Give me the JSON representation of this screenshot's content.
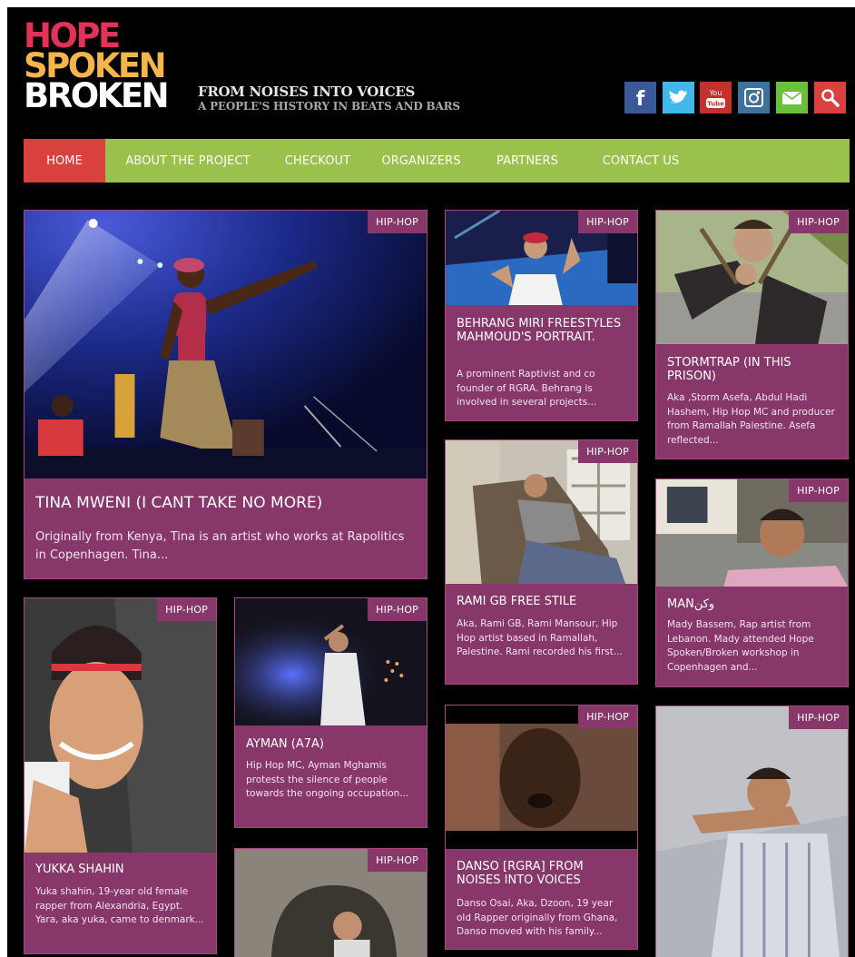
{
  "header": {
    "logo_lines": [
      {
        "text": "HOPE",
        "color": "#e2325a"
      },
      {
        "text": "SPOKEN",
        "color": "#f4b64a"
      },
      {
        "text": "BROKEN",
        "color": "#ffffff"
      }
    ],
    "tagline_1": "FROM NOISES INTO VOICES",
    "tagline_2": "A PEOPLE'S HISTORY IN BEATS AND BARS"
  },
  "social": [
    {
      "name": "facebook-icon",
      "color": "#3b5998",
      "glyph": "f"
    },
    {
      "name": "twitter-icon",
      "color": "#41b7ea",
      "glyph": "bird"
    },
    {
      "name": "youtube-icon",
      "color": "#c4302b",
      "glyph": "You"
    },
    {
      "name": "instagram-icon",
      "color": "#3f729b",
      "glyph": "camera"
    },
    {
      "name": "email-icon",
      "color": "#69c13a",
      "glyph": "envelope"
    },
    {
      "name": "search-icon",
      "color": "#d9413e",
      "glyph": "magnifier"
    }
  ],
  "nav": {
    "items": [
      "HOME",
      "ABOUT THE PROJECT",
      "CHECKOUT",
      "ORGANIZERS",
      "PARTNERS",
      "CONTACT US"
    ],
    "active_index": 0,
    "active_color": "#d9413e",
    "bar_color": "#9ac14b"
  },
  "category_label": "HIP-HOP",
  "posts": [
    {
      "title": "TINA MWENI (I CANT TAKE NO MORE)",
      "desc": "Originally from Kenya, Tina is an artist who works at Rapolitics in Copenhagen. Tina..."
    },
    {
      "title": "BEHRANG MIRI FREESTYLES MAHMOUD'S PORTRAIT.",
      "desc": "A prominent Raptivist and co founder of RGRA. Behrang is involved in several projects..."
    },
    {
      "title": "STORMTRAP (IN THIS PRISON)",
      "desc": "Aka ,Storm Asefa, Abdul Hadi Hashem, Hip Hop MC and producer from Ramallah Palestine. Asefa reflected..."
    },
    {
      "title": "RAMI GB FREE STILE",
      "desc": "Aka, Rami GB, Rami Mansour, Hip Hop artist based in Ramallah, Palestine. Rami recorded his first..."
    },
    {
      "title": "MANوكن",
      "desc": "Mady Bassem, Rap artist from Lebanon. Mady attended Hope Spoken/Broken workshop in Copenhagen and..."
    },
    {
      "title": "YUKKA SHAHIN",
      "desc": "Yuka shahin, 19-year old female rapper from Alexandria, Egypt. Yara, aka yuka, came to denmark..."
    },
    {
      "title": "AYMAN (A7A)",
      "desc": "Hip Hop MC, Ayman Mghamis protests the silence of people towards the ongoing occupation..."
    },
    {
      "title": "DANSO [RGRA] FROM NOISES INTO VOICES",
      "desc": "Danso Osai, Aka, Dzoon, 19 year old Rapper originally from Ghana, Danso moved with his family..."
    },
    {
      "title": "",
      "desc": ""
    },
    {
      "title": "",
      "desc": ""
    }
  ]
}
